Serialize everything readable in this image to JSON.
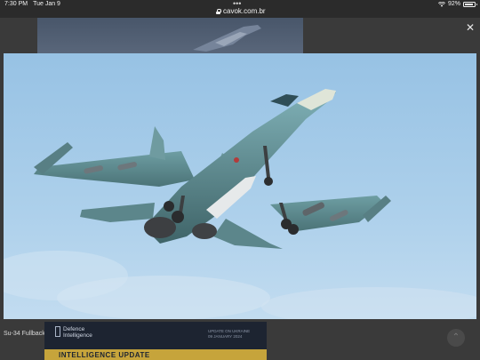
{
  "status_bar": {
    "time": "7:30 PM",
    "date": "Tue Jan 9",
    "dots": "•••",
    "url": "cavok.com.br",
    "battery": "92%",
    "battery_level": 0.92
  },
  "lightbox": {
    "close_label": "✕",
    "caption": "Su-34 Fullback."
  },
  "banner": {
    "org_line1": "Defence",
    "org_line2": "Intelligence",
    "date_line1": "Update on Ukraine",
    "date_line2": "09 January 2024",
    "title": "INTELLIGENCE UPDATE"
  },
  "scroll_up_label": "⌃",
  "colors": {
    "sky": "#b1d2ec",
    "aircraft": "#5f8c91",
    "banner_bg": "#1d2431",
    "banner_accent": "#c6a43b"
  }
}
